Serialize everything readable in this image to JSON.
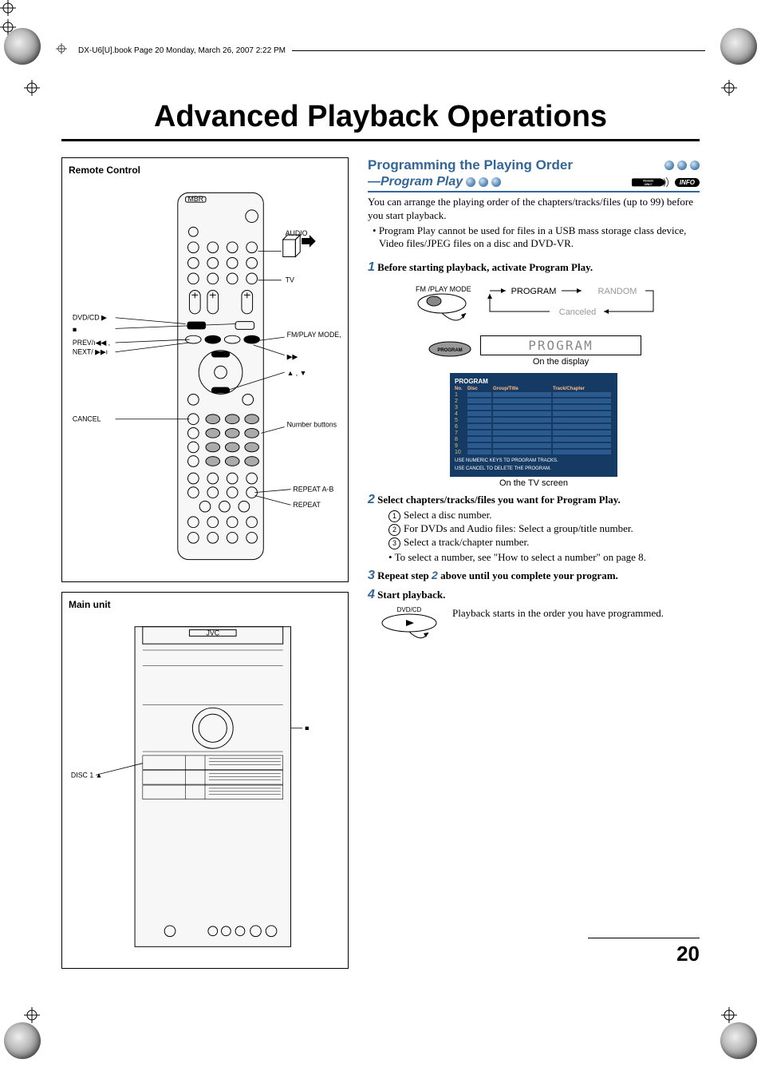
{
  "header": {
    "stamp": "DX-U6[U].book  Page 20  Monday, March 26, 2007  2:22 PM"
  },
  "title": "Advanced Playback Operations",
  "page_number": "20",
  "left": {
    "remote": {
      "title": "Remote Control",
      "labels": {
        "mbr": "MBR",
        "dvd_cd_play": "DVD/CD ▶",
        "stop": "■",
        "prev": "PREV/ı◀◀ ,",
        "next": "NEXT/ ▶▶ı",
        "cancel": "CANCEL",
        "audio": "AUDIO",
        "tv": "TV",
        "fm_playmode": "FM/PLAY MODE, ıı",
        "ff": "▶▶",
        "arrows": "▲ , ▼",
        "number_buttons": "Number buttons",
        "repeat_ab": "REPEAT A-B",
        "repeat": "REPEAT"
      }
    },
    "main_unit": {
      "title": "Main unit",
      "labels": {
        "jvc": "JVC",
        "disc1_eject": "DISC 1 ▲",
        "stop": "■"
      }
    }
  },
  "right": {
    "section_title": "Programming the Playing Order",
    "section_sub": "—Program Play",
    "remote_only_text": "Remote ONLY",
    "info_pill": "INFO",
    "intro1": "You can arrange the playing order of the chapters/tracks/files (up to 99) before you start playback.",
    "intro_bullet": "Program Play cannot be used for files in a USB mass storage class device, Video files/JPEG files on a disc and DVD-VR.",
    "step1": {
      "num": "1",
      "text": "Before starting playback, activate Program Play.",
      "fm_label": "FM /PLAY MODE",
      "arrow_a": "PROGRAM",
      "arrow_b": "RANDOM",
      "arrow_c": "Canceled",
      "program_small": "PROGRAM",
      "display_text": "PROGRAM",
      "on_display": "On the display",
      "tv": {
        "head": "PROGRAM",
        "cols": [
          "No.",
          "Disc",
          "Group/Title",
          "Track/Chapter"
        ],
        "rows": [
          "1",
          "2",
          "3",
          "4",
          "5",
          "6",
          "7",
          "8",
          "9",
          "10"
        ],
        "foot1": "USE NUMERIC KEYS TO PROGRAM TRACKS.",
        "foot2": "USE CANCEL TO DELETE THE PROGRAM."
      },
      "on_tv": "On the TV screen"
    },
    "step2": {
      "num": "2",
      "text": "Select chapters/tracks/files you want for Program Play.",
      "a": "Select a disc number.",
      "b": "For DVDs and Audio files: Select a group/title number.",
      "c": "Select a track/chapter number.",
      "note": "To select a number, see \"How to select a number\" on page 8."
    },
    "step3": {
      "num": "3",
      "text_a": "Repeat step ",
      "text_ref": "2",
      "text_b": " above until you complete your program."
    },
    "step4": {
      "num": "4",
      "text": "Start playback.",
      "btn_label": "DVD/CD",
      "result": "Playback starts in the order you have programmed."
    }
  }
}
